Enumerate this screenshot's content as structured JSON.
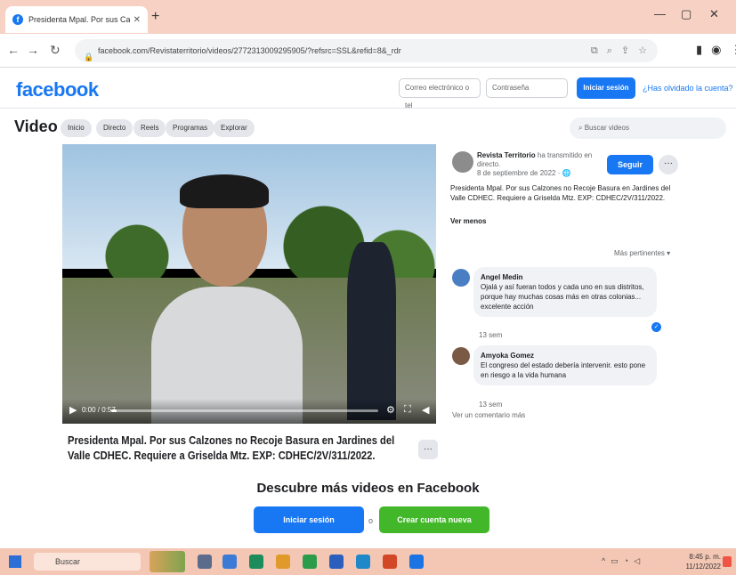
{
  "browser": {
    "tab_title": "Presidenta Mpal. Por sus Calzon",
    "tab_close": "✕",
    "new_tab": "+",
    "url": "facebook.com/Revistaterritorio/videos/2772313009295905/?refsrc=SSL&refid=8&_rdr",
    "win_minimize": "—",
    "win_maximize": "▢",
    "win_close": "✕",
    "back": "←",
    "forward": "→",
    "reload": "↻"
  },
  "fb_header": {
    "logo": "facebook",
    "email_placeholder": "Correo electrónico o tel",
    "password_placeholder": "Contraseña",
    "login_button": "Iniciar sesión",
    "forgot_link": "¿Has olvidado la cuenta?"
  },
  "video_nav": {
    "title": "Video",
    "pills": [
      "Inicio",
      "Directo",
      "Reels",
      "Programas",
      "Explorar"
    ],
    "search_placeholder": "Buscar videos"
  },
  "player": {
    "time": "0:00 / 0:57",
    "progress": 0.02
  },
  "caption": "Presidenta Mpal. Por sus Calzones no Recoje Basura en Jardines del Valle CDHEC. Requiere a Griselda Mtz. EXP: CDHEC/2V/311/2022.",
  "post": {
    "page_name": "Revista Territorio",
    "action": "ha transmitido en directo.",
    "date": "8 de septiembre de 2022 · 🌐",
    "follow": "Seguir",
    "more": "···",
    "text": "Presidenta Mpal. Por sus Calzones no Recoje Basura en Jardines del Valle CDHEC. Requiere a Griselda Mtz. EXP: CDHEC/2V/311/2022.",
    "see_less": "Ver menos",
    "sort": "Más pertinentes ▾"
  },
  "comments": [
    {
      "author": "Angel Medin",
      "text": "Ojalá y así fueran todos y cada uno en sus distritos, porque hay muchas cosas más en otras colonias... excelente acción",
      "meta": "13 sem"
    },
    {
      "author": "Amyoka Gomez",
      "text": "El congreso del estado debería intervenir. esto pone en riesgo a la vida humana",
      "meta": "13 sem"
    }
  ],
  "view_more_comments": "Ver un comentario más",
  "cta": {
    "title": "Descubre más videos en Facebook",
    "login": "Iniciar sesión",
    "or": "o",
    "create": "Crear cuenta nueva"
  },
  "taskbar": {
    "search": "Buscar",
    "clock_time": "8:45 p. m.",
    "clock_date": "11/12/2022"
  },
  "colors": {
    "fb_blue": "#1877f2",
    "green": "#42b72a",
    "taskbar": "#f4c7b5"
  }
}
